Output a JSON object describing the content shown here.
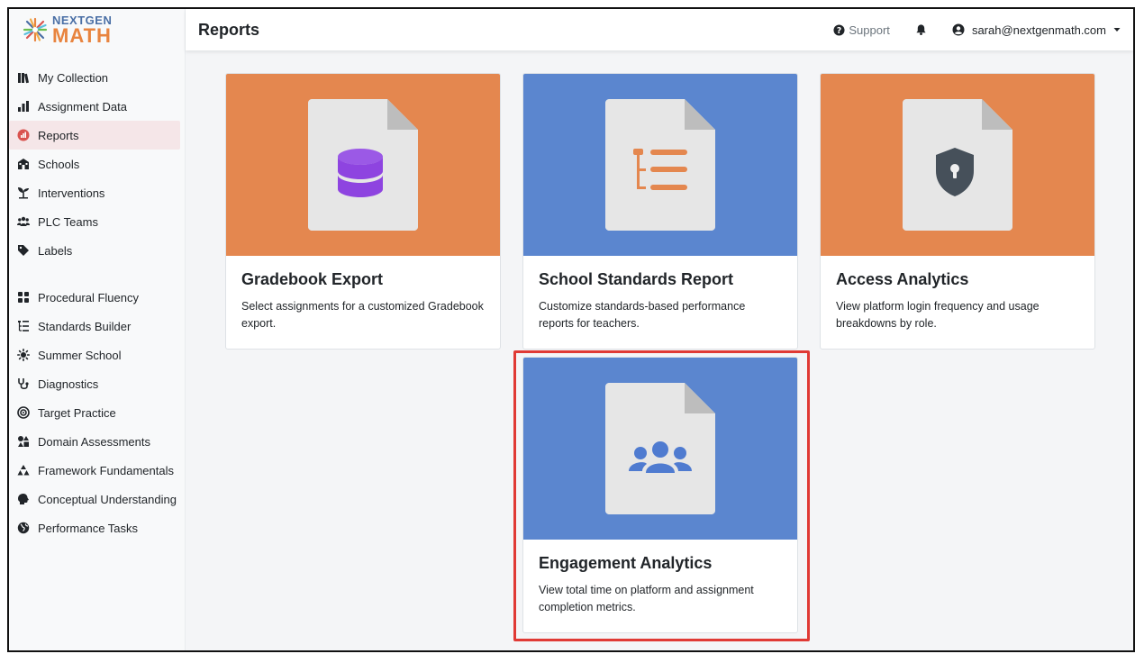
{
  "logo": {
    "top": "NEXTGEN",
    "bottom": "MATH"
  },
  "header": {
    "title": "Reports",
    "support_label": "Support",
    "user_email": "sarah@nextgenmath.com"
  },
  "sidebar": {
    "items": [
      {
        "label": "My Collection",
        "icon": "books-icon"
      },
      {
        "label": "Assignment Data",
        "icon": "bar-chart-icon"
      },
      {
        "label": "Reports",
        "icon": "report-icon",
        "active": true
      },
      {
        "label": "Schools",
        "icon": "school-icon"
      },
      {
        "label": "Interventions",
        "icon": "seedling-icon"
      },
      {
        "label": "PLC Teams",
        "icon": "users-icon"
      },
      {
        "label": "Labels",
        "icon": "tag-icon"
      },
      {
        "label": "Procedural Fluency",
        "icon": "grid-icon"
      },
      {
        "label": "Standards Builder",
        "icon": "tree-list-icon"
      },
      {
        "label": "Summer School",
        "icon": "sun-icon"
      },
      {
        "label": "Diagnostics",
        "icon": "stethoscope-icon"
      },
      {
        "label": "Target Practice",
        "icon": "target-icon"
      },
      {
        "label": "Domain Assessments",
        "icon": "shapes-icon"
      },
      {
        "label": "Framework Fundamentals",
        "icon": "triangle-stack-icon"
      },
      {
        "label": "Conceptual Understanding",
        "icon": "brain-icon"
      },
      {
        "label": "Performance Tasks",
        "icon": "globe-icon"
      }
    ]
  },
  "cards": [
    {
      "title": "Gradebook Export",
      "text": "Select assignments for a customized Gradebook export.",
      "color": "#e4874f",
      "icon": "database-icon"
    },
    {
      "title": "School Standards Report",
      "text": "Customize standards-based performance reports for teachers.",
      "color": "#5b86cf",
      "icon": "tree-list-icon"
    },
    {
      "title": "Access Analytics",
      "text": "View platform login frequency and usage breakdowns by role.",
      "color": "#e4874f",
      "icon": "shield-lock-icon"
    },
    {
      "title": "Engagement Analytics",
      "text": "View total time on platform and assignment completion metrics.",
      "color": "#5b86cf",
      "icon": "users-icon"
    }
  ],
  "colors": {
    "accent_orange": "#e4874f",
    "accent_blue": "#5b86cf",
    "highlight": "#e03a35",
    "active_bg": "#f5e6e8"
  }
}
